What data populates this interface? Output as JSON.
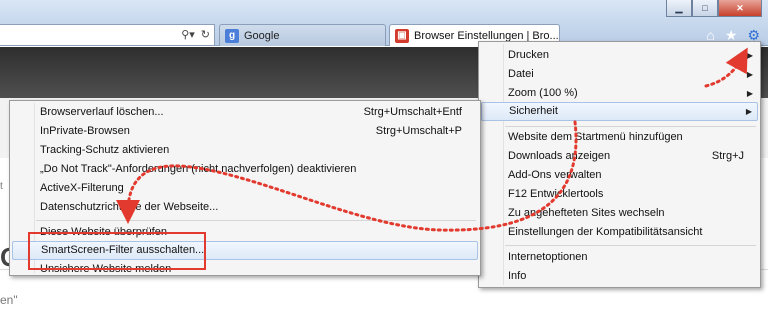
{
  "browser": {
    "tabs": [
      {
        "label": "Google",
        "icon": "google-favicon-icon"
      },
      {
        "label": "Browser Einstellungen | Bro...",
        "icon": "site-favicon-icon",
        "active": true
      }
    ],
    "address_icons": [
      "search-dropdown-icon",
      "refresh-icon"
    ],
    "command_icons": [
      "home-icon",
      "favorites-star-icon",
      "gear-icon"
    ],
    "window_controls": [
      "minimize-icon",
      "maximize-icon",
      "close-icon"
    ]
  },
  "page": {
    "frag_g": "G",
    "frag_en": "en\"",
    "frag_t": "t"
  },
  "main_menu": {
    "items": [
      {
        "label": "Drucken",
        "submenu": true
      },
      {
        "label": "Datei",
        "submenu": true
      },
      {
        "label": "Zoom (100 %)",
        "submenu": true
      },
      {
        "label": "Sicherheit",
        "submenu": true,
        "highlighted": true
      },
      {
        "label": "Website dem Startmenü hinzufügen"
      },
      {
        "label": "Downloads anzeigen",
        "shortcut": "Strg+J"
      },
      {
        "label": "Add-Ons verwalten"
      },
      {
        "label": "F12 Entwicklertools"
      },
      {
        "label": "Zu angehefteten Sites wechseln"
      },
      {
        "label": "Einstellungen der Kompatibilitätsansicht"
      },
      {
        "label": "Internetoptionen"
      },
      {
        "label": "Info"
      }
    ]
  },
  "sub_menu": {
    "items": [
      {
        "label": "Browserverlauf löschen...",
        "shortcut": "Strg+Umschalt+Entf"
      },
      {
        "label": "InPrivate-Browsen",
        "shortcut": "Strg+Umschalt+P"
      },
      {
        "label": "Tracking-Schutz aktivieren"
      },
      {
        "label": "„Do Not Track\"-Anforderungen (nicht nachverfolgen) deaktivieren"
      },
      {
        "label": "ActiveX-Filterung"
      },
      {
        "label": "Datenschutzrichtlinie der Webseite..."
      },
      {
        "label": "Diese Website überprüfen"
      },
      {
        "label": "SmartScreen-Filter ausschalten...",
        "highlighted": true
      },
      {
        "label": "Unsichere Website melden"
      }
    ]
  },
  "colors": {
    "annotation": "#e23a2e",
    "highlight": "#dde9f8"
  }
}
